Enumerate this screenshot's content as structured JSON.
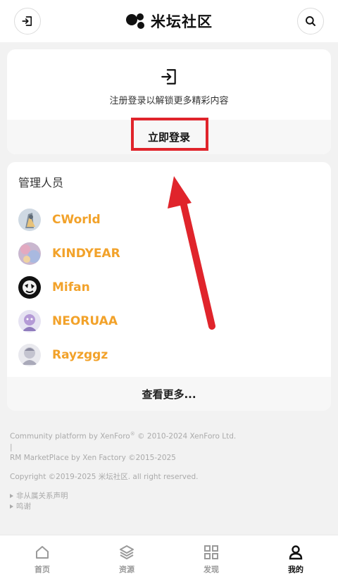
{
  "header": {
    "logo_text": "米坛社区",
    "login_icon": "login-icon",
    "search_icon": "search-icon"
  },
  "login_card": {
    "icon": "login-icon",
    "hint": "注册登录以解锁更多精彩内容",
    "button_label": "立即登录"
  },
  "staff": {
    "title": "管理人员",
    "members": [
      {
        "name": "CWorld"
      },
      {
        "name": "KINDYEAR"
      },
      {
        "name": "Mifan"
      },
      {
        "name": "NEORUAA"
      },
      {
        "name": "Rayzggz"
      }
    ],
    "more_label": "查看更多..."
  },
  "footer": {
    "line1_prefix": "Community platform by XenForo",
    "line1_reg": "®",
    "line1_suffix": " © 2010-2024 XenForo Ltd.",
    "separator": "|",
    "line2": "RM MarketPlace by Xen Factory ©2015-2025",
    "copyright": "Copyright ©2019-2025 米坛社区. all right reserved.",
    "links": [
      "非从属关系声明",
      "鸣谢"
    ]
  },
  "tabbar": {
    "tabs": [
      {
        "label": "首页",
        "icon": "home-icon",
        "active": false
      },
      {
        "label": "资源",
        "icon": "layers-icon",
        "active": false
      },
      {
        "label": "发现",
        "icon": "grid-icon",
        "active": false
      },
      {
        "label": "我的",
        "icon": "user-icon",
        "active": true
      }
    ]
  },
  "colors": {
    "accent_name": "#f2a22a",
    "highlight_red": "#e0242b",
    "background": "#f2f2f2"
  }
}
